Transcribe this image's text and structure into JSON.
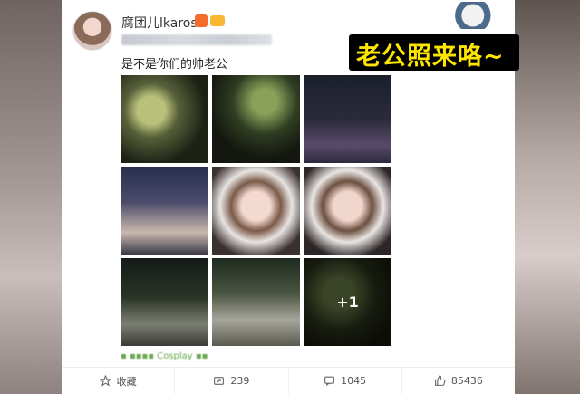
{
  "post": {
    "username": "腐团儿lkaros",
    "text": "是不是你们的帅老公",
    "more_count": "+1"
  },
  "overlay": {
    "caption": "老公照来咯~"
  },
  "actions": {
    "favorite_label": "收藏",
    "repost_count": "239",
    "comment_count": "1045",
    "like_count": "85436"
  },
  "colors": {
    "caption_text": "#ffe600",
    "caption_bg": "#000000",
    "source_text": "#6aa84f"
  },
  "icons": [
    "star-icon",
    "repost-icon",
    "comment-icon",
    "like-icon"
  ]
}
